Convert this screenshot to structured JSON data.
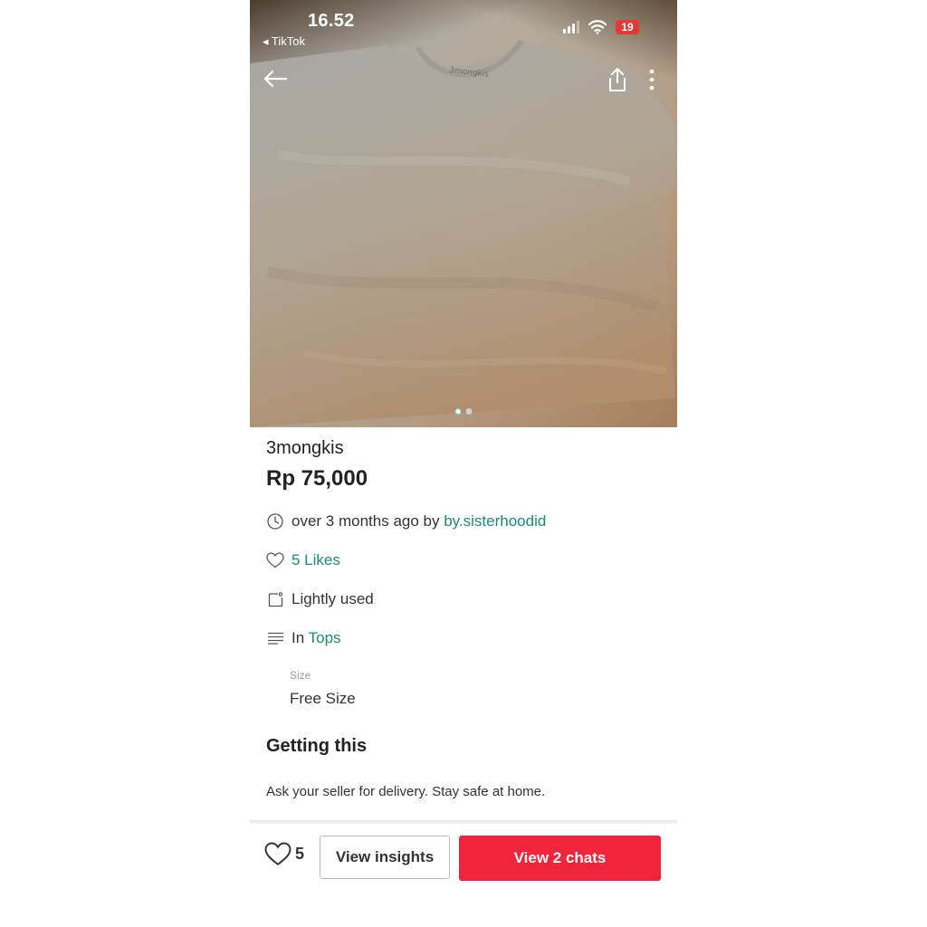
{
  "status_bar": {
    "time": "16.52",
    "back_app": "◂ TikTok",
    "battery": "19"
  },
  "photo": {
    "shirt_label": "3mongkis",
    "page_count": 2,
    "active_page": 1
  },
  "listing": {
    "title": "3mongkis",
    "price": "Rp 75,000",
    "posted_text": "over 3 months ago by",
    "seller": "by.sisterhoodid",
    "likes": "5 Likes",
    "condition": "Lightly used",
    "category_prefix": "In",
    "category": "Tops",
    "size_label": "Size",
    "size_value": "Free Size"
  },
  "getting": {
    "title": "Getting this",
    "note": "Ask your seller for delivery. Stay safe at home."
  },
  "bottom_bar": {
    "like_count": "5",
    "insights_label": "View insights",
    "chats_label": "View 2 chats"
  },
  "colors": {
    "accent_link": "#1f8a70",
    "primary_button": "#f0243b",
    "battery_low": "#e53935"
  }
}
